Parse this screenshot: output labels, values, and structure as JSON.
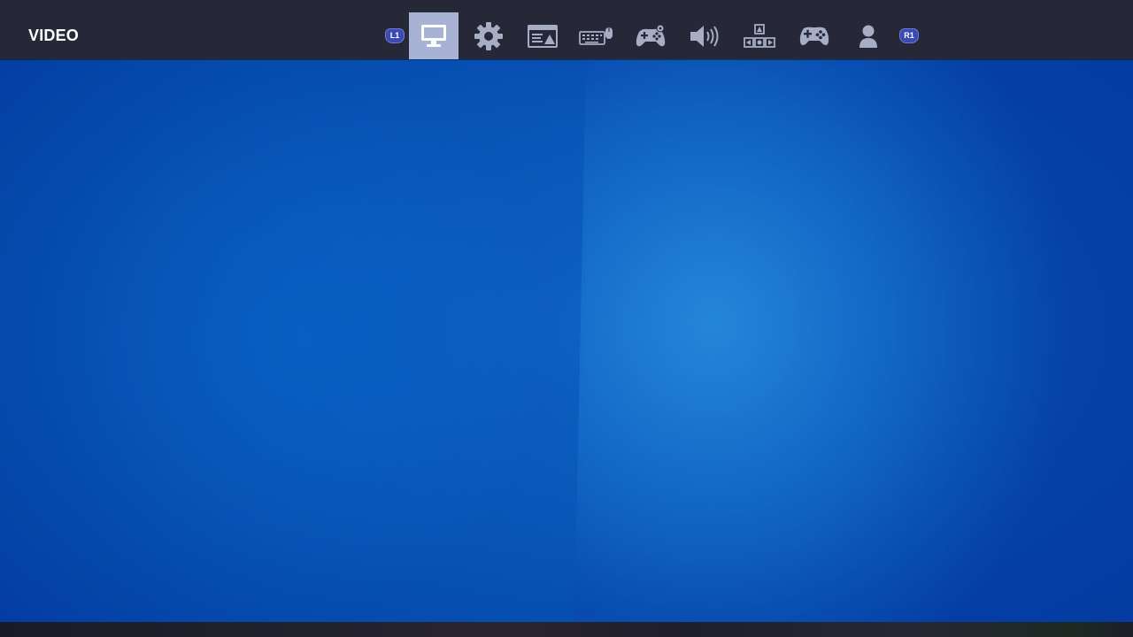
{
  "header": {
    "title": "VIDEO"
  },
  "bumpers": {
    "left": "L1",
    "right": "R1"
  },
  "tabs": [
    {
      "icon": "monitor-icon",
      "active": true
    },
    {
      "icon": "gear-icon",
      "active": false
    },
    {
      "icon": "hud-layout-icon",
      "active": false
    },
    {
      "icon": "keyboard-mouse-icon",
      "active": false
    },
    {
      "icon": "controller-settings-icon",
      "active": false
    },
    {
      "icon": "speaker-icon",
      "active": false
    },
    {
      "icon": "accessibility-icon",
      "active": false
    },
    {
      "icon": "gamepad-icon",
      "active": false
    },
    {
      "icon": "account-icon",
      "active": false
    }
  ],
  "colors": {
    "top_bar": "#262838",
    "active_tab": "#a7b2d4",
    "icon": "#a6adc4",
    "active_icon": "#ffffff",
    "background_blue": "#0856b8"
  }
}
